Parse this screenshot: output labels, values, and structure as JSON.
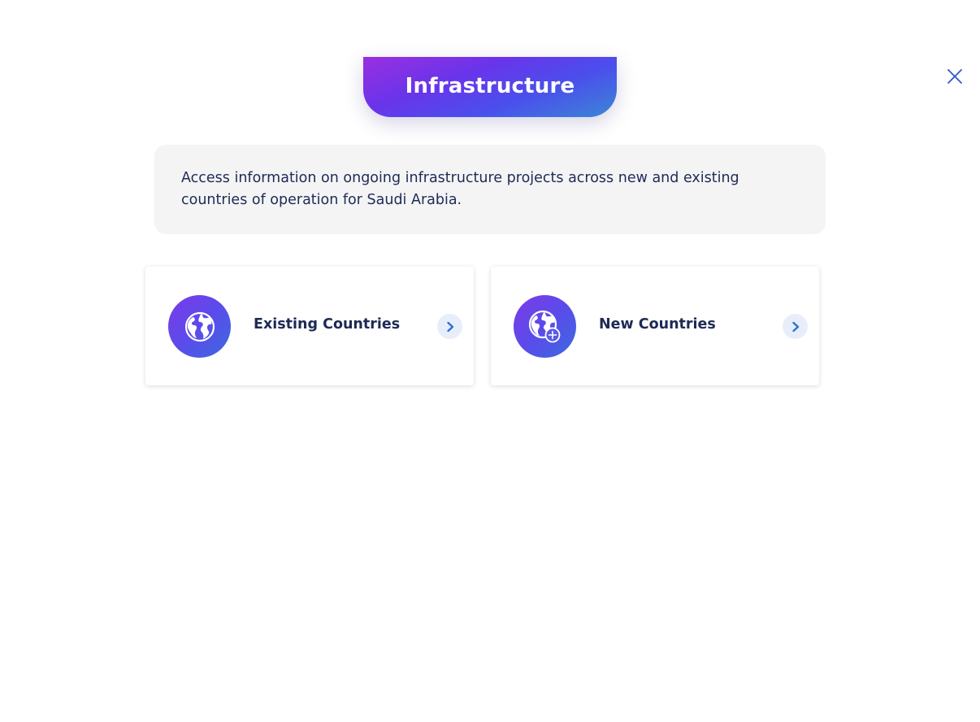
{
  "header": {
    "title": "Infrastructure"
  },
  "close": {
    "icon": "close-icon"
  },
  "info": {
    "text": "Access information on ongoing infrastructure projects across new and existing countries of operation for Saudi Arabia."
  },
  "cards": [
    {
      "label": "Existing Countries",
      "icon": "globe-icon",
      "action_icon": "chevron-right-icon"
    },
    {
      "label": "New Countries",
      "icon": "globe-plus-icon",
      "action_icon": "chevron-right-icon"
    }
  ],
  "colors": {
    "accent_start": "#9a2fe0",
    "accent_end": "#3c86d6",
    "text_primary": "#1e2a55",
    "chevron": "#2f6fd6",
    "chevron_bg": "#e8eef9",
    "panel_bg": "#f4f4f5"
  }
}
